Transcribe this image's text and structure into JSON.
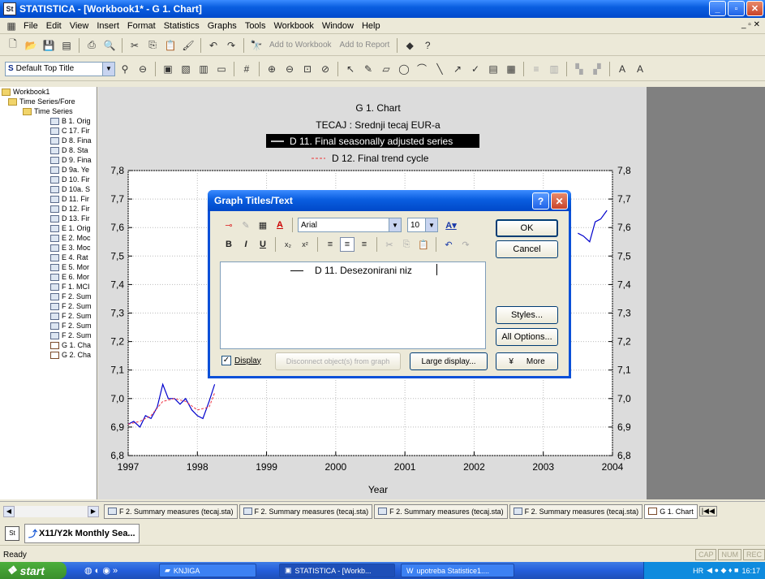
{
  "window": {
    "title": "STATISTICA - [Workbook1* - G 1. Chart]"
  },
  "menu": [
    "File",
    "Edit",
    "View",
    "Insert",
    "Format",
    "Statistics",
    "Graphs",
    "Tools",
    "Workbook",
    "Window",
    "Help"
  ],
  "toolbar": {
    "add_to_workbook": "Add to Workbook",
    "add_to_report": "Add to Report",
    "style_combo": "Default Top Title"
  },
  "tree": {
    "root": "Workbook1",
    "items": [
      "Time Series/Fore",
      "Time Series",
      "B 1. Orig",
      "C 17. Fir",
      "D 8. Fina",
      "D 8. Sta",
      "D 9. Fina",
      "D 9a. Ye",
      "D 10. Fir",
      "D 10a. S",
      "D 11. Fir",
      "D 12. Fir",
      "D 13. Fir",
      "E 1. Orig",
      "E 2. Moc",
      "E 3. Moc",
      "E 4. Rat",
      "E 5. Mor",
      "E 6. Mor",
      "F 1. MCI",
      "F 2. Sum",
      "F 2. Sum",
      "F 2. Sum",
      "F 2. Sum",
      "F 2. Sum",
      "G 1. Cha",
      "G 2. Cha"
    ]
  },
  "chart": {
    "title": "G 1. Chart",
    "subtitle": "TECAJ   : Srednji tecaj EUR-a",
    "legend_series_1": "D 11. Final seasonally adjusted series",
    "legend_series_2": "D 12. Final trend cycle",
    "xlabel": "Year"
  },
  "chart_data": {
    "type": "line",
    "xlim": [
      1997,
      2004
    ],
    "ylim": [
      6.8,
      7.8
    ],
    "x_ticks": [
      "1997",
      "1998",
      "1999",
      "2000",
      "2001",
      "2002",
      "2003",
      "2004"
    ],
    "y_ticks": [
      "7,8",
      "7,7",
      "7,6",
      "7,5",
      "7,4",
      "7,3",
      "7,2",
      "7,1",
      "7,0",
      "6,9",
      "6,8"
    ],
    "grid": true,
    "series": [
      {
        "name": "D 11. Final seasonally adjusted series",
        "style": "solid",
        "color": "#0000cc",
        "x": [
          1997.0,
          1997.08,
          1997.17,
          1997.25,
          1997.33,
          1997.42,
          1997.5,
          1997.58,
          1997.67,
          1997.75,
          1997.83,
          1997.92,
          1998.0,
          1998.08,
          1998.17,
          1998.25
        ],
        "y": [
          6.91,
          6.92,
          6.9,
          6.94,
          6.93,
          6.97,
          7.05,
          7.0,
          7.0,
          6.98,
          7.0,
          6.96,
          6.94,
          6.93,
          6.99,
          7.05
        ],
        "x_end": [
          2003.5,
          2003.58,
          2003.67,
          2003.75,
          2003.83,
          2003.92
        ],
        "y_end": [
          7.58,
          7.57,
          7.55,
          7.62,
          7.63,
          7.66
        ]
      },
      {
        "name": "D 12. Final trend cycle",
        "style": "dashed",
        "color": "#ee3344",
        "x": [
          1997.0,
          1997.17,
          1997.33,
          1997.5,
          1997.67,
          1997.83,
          1998.0,
          1998.17,
          1998.25
        ],
        "y": [
          6.91,
          6.92,
          6.94,
          6.99,
          7.0,
          6.99,
          6.96,
          6.97,
          7.02
        ]
      }
    ]
  },
  "dialog": {
    "title": "Graph Titles/Text",
    "font": "Arial",
    "size": "10",
    "text": "D 11. Desezonirani niz",
    "ok": "OK",
    "cancel": "Cancel",
    "styles": "Styles...",
    "all_options": "All Options...",
    "display": "Display",
    "disconnect": "Disconnect object(s) from graph",
    "large_display": "Large display...",
    "more": "More"
  },
  "tabs": [
    "F 2. Summary measures (tecaj.sta)",
    "F 2. Summary measures (tecaj.sta)",
    "F 2. Summary measures (tecaj.sta)",
    "F 2. Summary measures (tecaj.sta)",
    "G 1. Chart"
  ],
  "task_item": "X11/Y2k Monthly Sea...",
  "status": {
    "ready": "Ready",
    "cap": "CAP",
    "num": "NUM",
    "rec": "REC"
  },
  "taskbar": {
    "start": "start",
    "btn1": "KNJIGA",
    "btn2": "STATISTICA - [Workb...",
    "btn3": "upotreba Statistice1....",
    "lang": "HR",
    "clock": "16:17"
  }
}
